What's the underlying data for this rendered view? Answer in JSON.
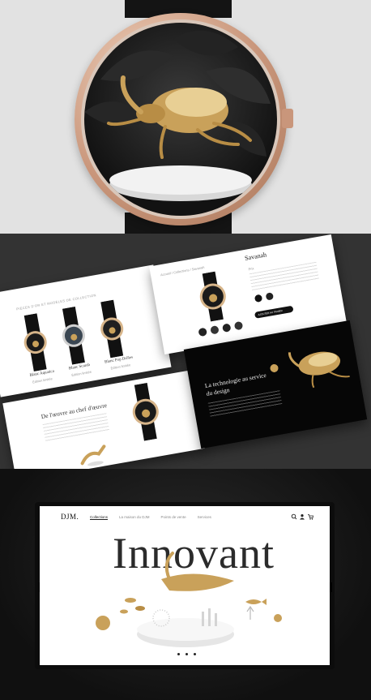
{
  "showcase": {
    "card1": {
      "overline": "PIÈCES D'OR ET MODÈLES DE COLLECTION",
      "products": [
        {
          "name": "Blanc Aquatica",
          "sub": "Édition limitée"
        },
        {
          "name": "Blanc Scarab",
          "sub": "Édition limitée"
        },
        {
          "name": "Blanc Pop Drôles",
          "sub": "Édition limitée"
        }
      ]
    },
    "card2": {
      "breadcrumb": "Accueil / Collections / Savanah",
      "title": "Savanah",
      "price": "Prix",
      "cta": "AJOUTER AU PANIER"
    },
    "card3": {
      "heading": "De l'œuvre au chef d'œuvre"
    },
    "card4": {
      "heading_line1": "La technologie au service",
      "heading_line2": "du design"
    }
  },
  "site": {
    "logo": "DJM.",
    "nav": [
      "Collections",
      "La maison du DJM",
      "Points de vente",
      "Services"
    ],
    "hero_title": "Innovant",
    "slider_dots": 3
  },
  "colors": {
    "gold": "#c9a15a",
    "rose_gold": "#c9967b",
    "dark": "#333333"
  }
}
